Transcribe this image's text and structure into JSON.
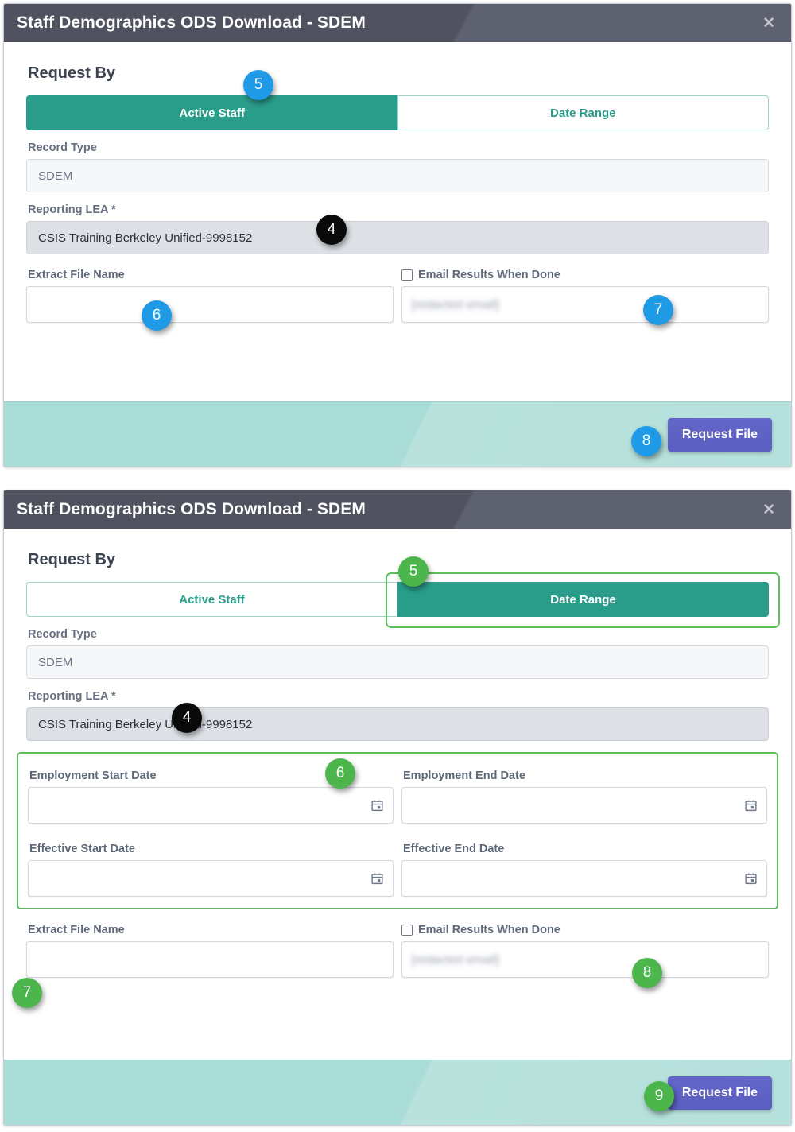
{
  "window": {
    "title": "Staff Demographics ODS Download - SDEM",
    "close_label": "✕"
  },
  "panel_active_staff": {
    "section_heading": "Request By",
    "tabs": [
      {
        "label": "Active Staff",
        "state": "active"
      },
      {
        "label": "Date Range",
        "state": "inactive"
      }
    ],
    "record_type": {
      "label": "Record Type",
      "value": "SDEM"
    },
    "reporting_lea": {
      "label": "Reporting LEA *",
      "value": "CSIS Training Berkeley Unified-9998152"
    },
    "extract_file_name": {
      "label": "Extract File Name",
      "value": ""
    },
    "email_results": {
      "label": "Email Results When Done",
      "checked": false,
      "value": "[redacted email]"
    },
    "footer": {
      "request_file_label": "Request File"
    },
    "badges": [
      {
        "number": "4",
        "color": "black"
      },
      {
        "number": "5",
        "color": "blue"
      },
      {
        "number": "6",
        "color": "blue"
      },
      {
        "number": "7",
        "color": "blue"
      },
      {
        "number": "8",
        "color": "blue"
      }
    ]
  },
  "panel_date_range": {
    "section_heading": "Request By",
    "tabs": [
      {
        "label": "Active Staff",
        "state": "inactive"
      },
      {
        "label": "Date Range",
        "state": "active"
      }
    ],
    "record_type": {
      "label": "Record Type",
      "value": "SDEM"
    },
    "reporting_lea": {
      "label": "Reporting LEA *",
      "value": "CSIS Training Berkeley Unified-9998152"
    },
    "date_fields": [
      {
        "label": "Employment Start Date",
        "value": "",
        "icon": "calendar-icon"
      },
      {
        "label": "Employment End Date",
        "value": "",
        "icon": "calendar-icon"
      },
      {
        "label": "Effective Start Date",
        "value": "",
        "icon": "calendar-icon"
      },
      {
        "label": "Effective End Date",
        "value": "",
        "icon": "calendar-icon"
      }
    ],
    "extract_file_name": {
      "label": "Extract File Name",
      "value": ""
    },
    "email_results": {
      "label": "Email Results When Done",
      "checked": false,
      "value": "[redacted email]"
    },
    "footer": {
      "request_file_label": "Request File"
    },
    "badges": [
      {
        "number": "4",
        "color": "black"
      },
      {
        "number": "5",
        "color": "green"
      },
      {
        "number": "6",
        "color": "green"
      },
      {
        "number": "7",
        "color": "green"
      },
      {
        "number": "8",
        "color": "green"
      },
      {
        "number": "9",
        "color": "green"
      }
    ]
  },
  "colors": {
    "titlebar": "#50525f",
    "tab_active": "#2a9d8a",
    "tab_text": "#2a9d8a",
    "footer": "#a9dbd7",
    "primary_button": "#5e62c4",
    "badge_blue": "#1f9ae6",
    "badge_black": "#0a0a0a",
    "badge_green": "#4cb64c",
    "highlight_outline": "#5cbf5c",
    "readonly_grey": "#dde1e6"
  }
}
